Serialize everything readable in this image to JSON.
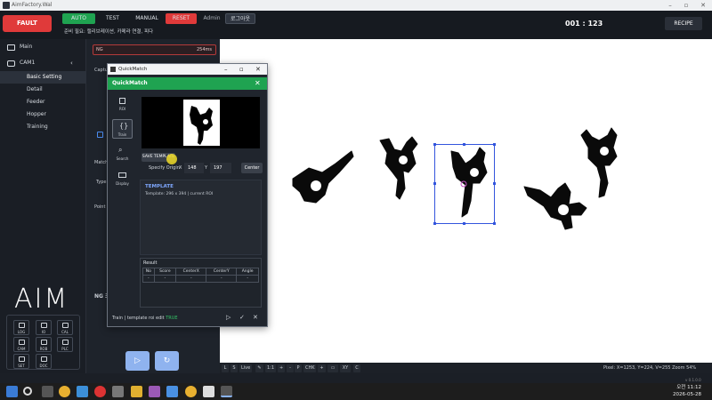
{
  "window": {
    "title": "AimFactory.Wal"
  },
  "topbar": {
    "fault": "FAULT",
    "auto": "AUTO",
    "test": "TEST",
    "manual": "MANUAL",
    "reset": "RESET",
    "user": "Admin",
    "logout": "로그아웃",
    "notice": "준비 필요: 캘리브레이션, 카메라 연결, 피다",
    "counter": "001 : 123",
    "recipe": "RECIPE"
  },
  "sidebar": {
    "main": "Main",
    "cam": "CAM1",
    "items": [
      "Basic Setting",
      "Detail",
      "Feeder",
      "Hopper",
      "Training"
    ],
    "logo": "AIM",
    "tiles": [
      "LOG",
      "IO",
      "CAL",
      "CAM",
      "ROB",
      "PLC",
      "SET",
      "DOC"
    ]
  },
  "settings": {
    "ng": "NG",
    "ng_value": "254ms",
    "capture": "Captu",
    "match": "Match",
    "type": "Type",
    "point": "Point",
    "ng_section": "NG 조"
  },
  "dialog": {
    "title": "QuickMatch",
    "header": "QuickMatch",
    "tabs": [
      "ROI",
      "Train",
      "Search",
      "Display"
    ],
    "save": "SAVE TEMPLATE",
    "origin_label": "Specify Origin",
    "x_label": "X",
    "x_value": "148",
    "y_label": "Y",
    "y_value": "197",
    "center": "Center",
    "template_title": "TEMPLATE",
    "template_info": "Template: 296 x 394 | current ROI",
    "result_title": "Result",
    "result_headers": [
      "No",
      "Score",
      "CenterX",
      "CenterY",
      "Angle"
    ],
    "result_row": [
      "-",
      "-",
      "-",
      "-",
      "-"
    ],
    "footer_label": "Train | template roi edit",
    "footer_status": "TRUE"
  },
  "viewer": {
    "tools": [
      "L",
      "S",
      "Live",
      "1:1",
      "+",
      "-",
      "P",
      "CHK",
      "XY",
      "C"
    ],
    "pixel": "Pixel: X=1253, Y=224, V=255   Zoom 54%"
  },
  "version": "v 0.1.0.0",
  "clock": {
    "time": "오전 11:12",
    "date": "2026-05-28"
  }
}
